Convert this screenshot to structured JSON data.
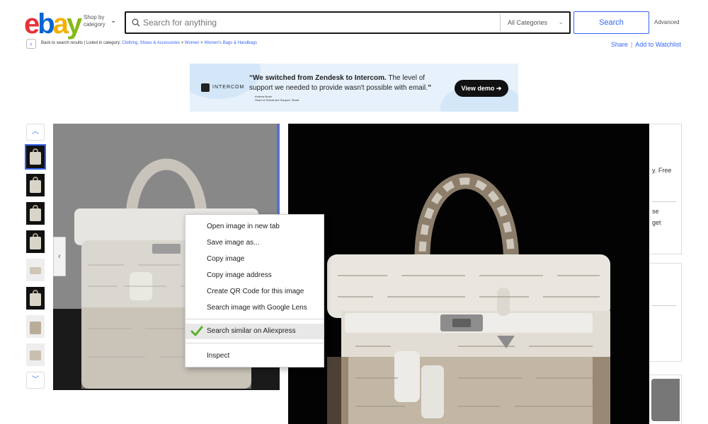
{
  "header": {
    "logo": {
      "e": "e",
      "b": "b",
      "a": "a",
      "y": "y"
    },
    "shop_by": "Shop by category",
    "search_placeholder": "Search for anything",
    "category": "All Categories",
    "search_button": "Search",
    "advanced": "Advanced"
  },
  "breadcrumb": {
    "back_label": "Back to search results",
    "listed_in": "Listed in category:",
    "items": [
      "Clothing, Shoes & Accessories",
      "Women",
      "Women's Bags & Handbags"
    ],
    "separator": ">"
  },
  "actions": {
    "share": "Share",
    "watchlist": "Add to Watchlist",
    "sep": "|"
  },
  "ad": {
    "brand": "INTERCOM",
    "quote_bold": "We switched from Zendesk to Intercom.",
    "quote_rest": " The level of support we needed to provide wasn't possible with email.",
    "open_quote": "“",
    "close_quote": "”",
    "author_name": "Andrew Bush",
    "author_title": "Head of Global and Support, Stuart",
    "cta": "View demo ➔"
  },
  "gallery": {
    "up_arrow": "︿",
    "down_arrow": "﹀",
    "prev_arrow": "‹",
    "thumb_count": 8
  },
  "side_panel": {
    "snippet_1": "y. Free",
    "snippet_2": "se",
    "snippet_3": "get"
  },
  "context_menu": {
    "items": [
      "Open image in new tab",
      "Save image as...",
      "Copy image",
      "Copy image address",
      "Create QR Code for this image",
      "Search image with Google Lens",
      "Search similar on Aliexpress",
      "Inspect"
    ],
    "highlighted_index": 6,
    "check_color": "#5db130"
  },
  "colors": {
    "accent": "#3665f3",
    "ebay_red": "#e53238",
    "ebay_blue": "#0064d2",
    "ebay_yellow": "#f5af02",
    "ebay_green": "#86b817"
  }
}
